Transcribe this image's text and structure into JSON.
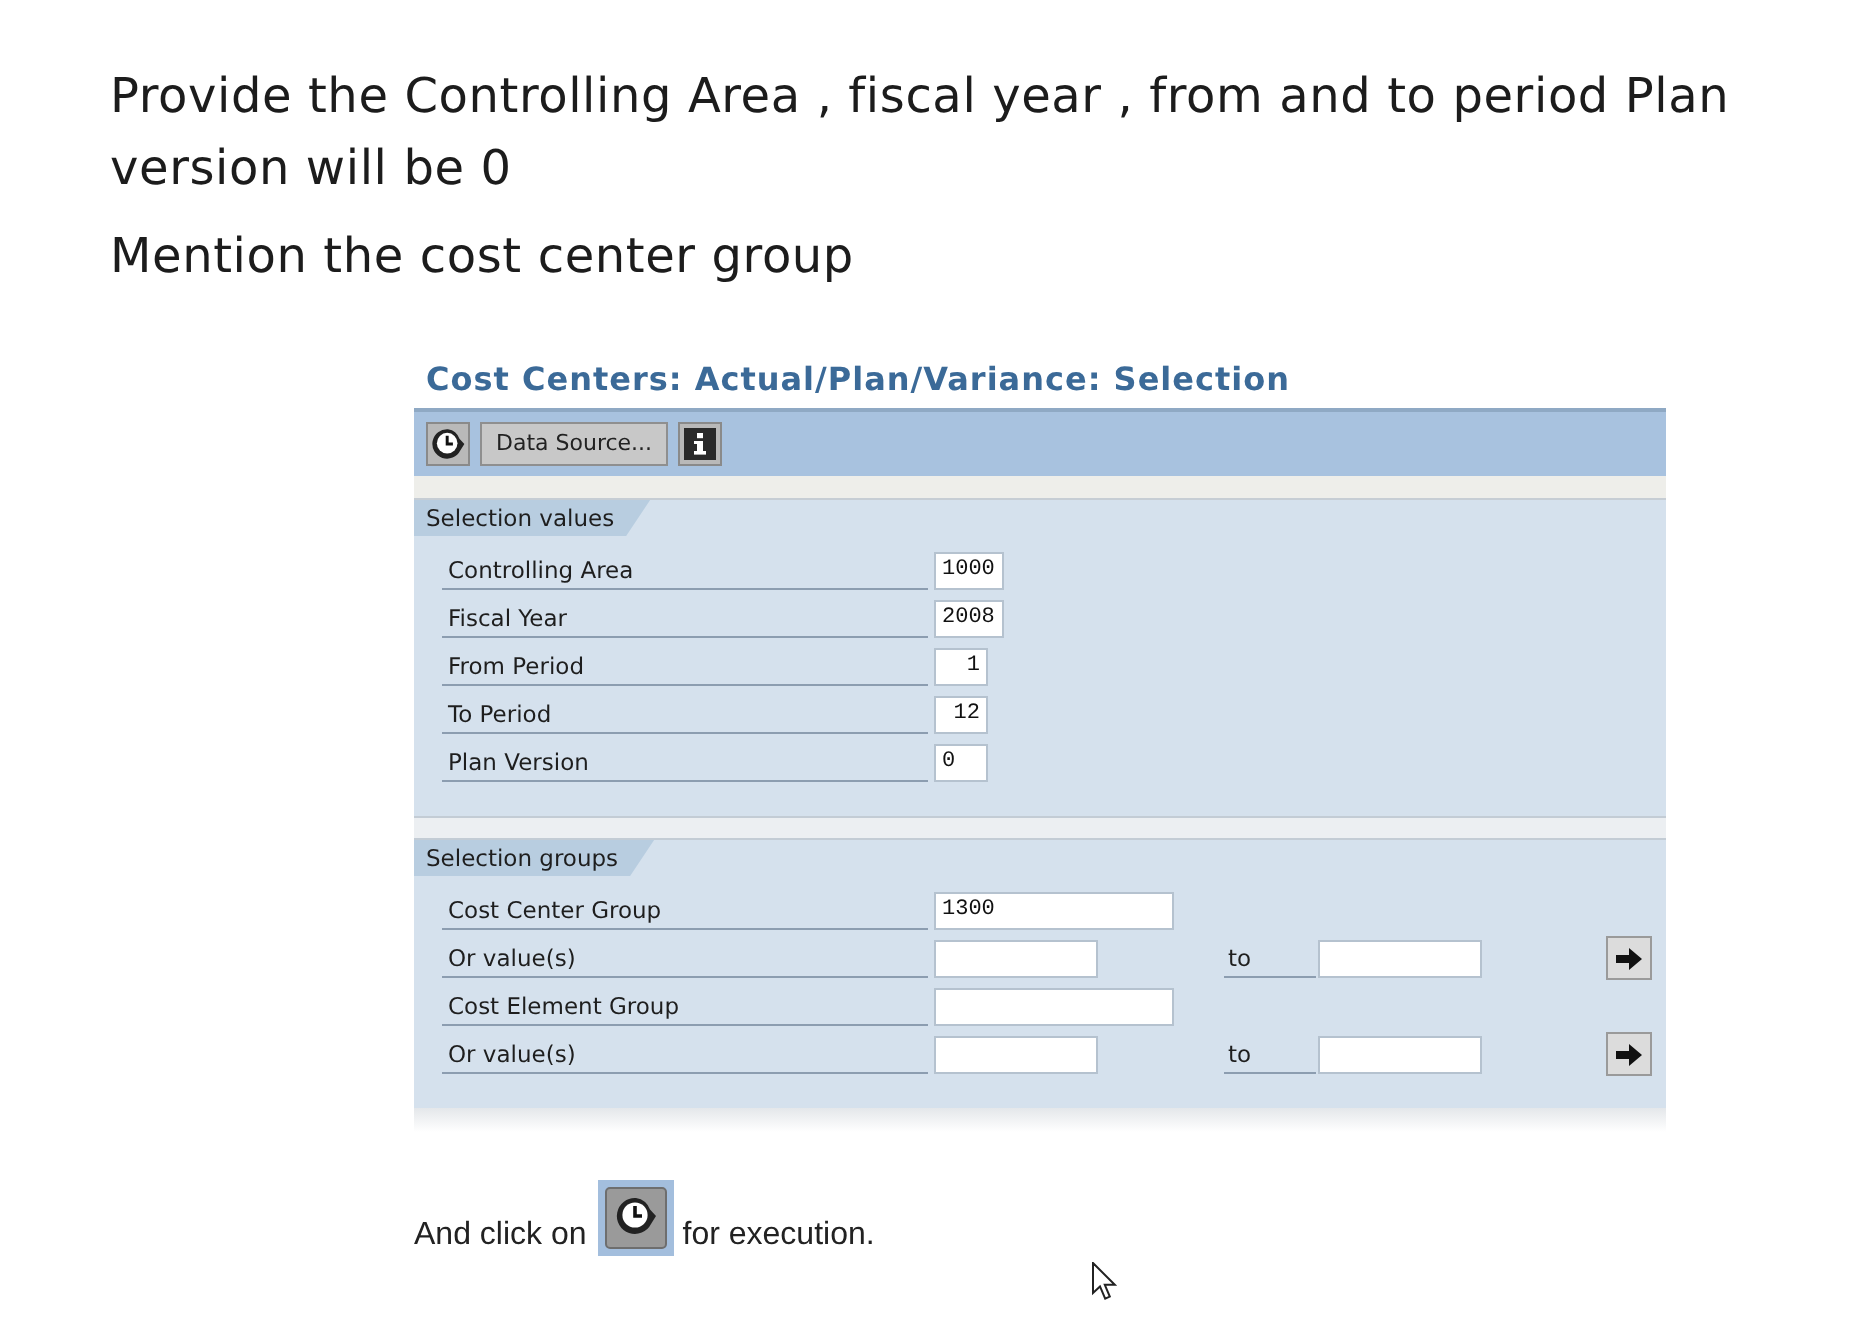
{
  "instructions": [
    {
      "text": "Provide the Controlling Area , fiscal year , from and to period Plan version will be 0"
    },
    {
      "text": "Mention the cost center group"
    }
  ],
  "screen": {
    "title": "Cost Centers: Actual/Plan/Variance: Selection",
    "toolbar": [
      {
        "kind": "execute"
      },
      {
        "kind": "text",
        "label": "Data Source..."
      },
      {
        "kind": "info"
      }
    ],
    "sections": [
      {
        "title": "Selection values",
        "rows": [
          {
            "kind": "key",
            "label": "Controlling Area",
            "value": "1000"
          },
          {
            "kind": "key",
            "label": "Fiscal Year",
            "value": "2008"
          },
          {
            "kind": "period",
            "label": "From Period",
            "value": "1"
          },
          {
            "kind": "period",
            "label": "To Period",
            "value": "12"
          },
          {
            "kind": "version",
            "label": "Plan Version",
            "value": "0"
          }
        ]
      },
      {
        "title": "Selection groups",
        "rows": [
          {
            "kind": "group",
            "label": "Cost Center Group",
            "value": "1300"
          },
          {
            "kind": "range",
            "label": "Or value(s)",
            "to_label": "to"
          },
          {
            "kind": "group",
            "label": "Cost Element Group"
          },
          {
            "kind": "range",
            "label": "Or value(s)",
            "to_label": "to"
          }
        ]
      }
    ]
  },
  "footer": {
    "before": "And click on",
    "after": "for execution."
  }
}
